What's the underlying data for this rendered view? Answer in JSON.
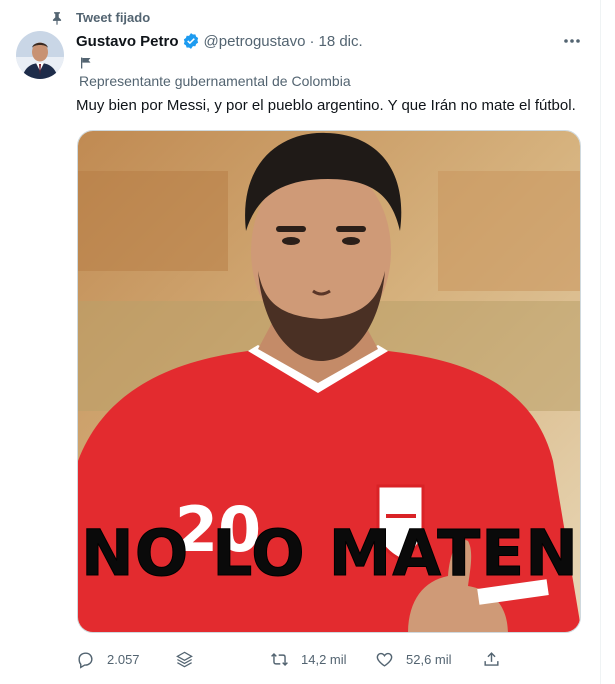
{
  "pinned": {
    "label": "Tweet fijado",
    "icon": "pin-icon"
  },
  "author": {
    "name": "Gustavo Petro",
    "handle": "@petrogustavo",
    "separator": "·",
    "date": "18 dic.",
    "verified_color": "#1d9bf0"
  },
  "label": {
    "icon": "flag-icon",
    "text": "Representante gubernamental de Colombia"
  },
  "tweet": {
    "text": "Muy bien por Messi, y por el pueblo argentino. Y que Irán no mate el fútbol.",
    "image_overlay_text": "NO LO MATEN",
    "jersey_number": "20"
  },
  "actions": {
    "replies": "2.057",
    "retweets": "14,2 mil",
    "likes": "52,6 mil"
  }
}
